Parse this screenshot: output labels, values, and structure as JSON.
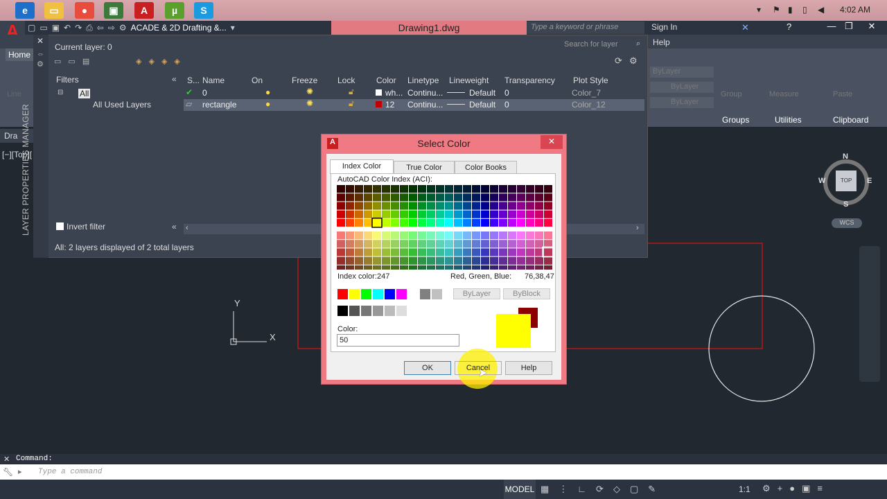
{
  "taskbar": {
    "time": "4:02 AM"
  },
  "title_bar": {
    "workspace": "ACADE & 2D Drafting &...",
    "document": "Drawing1.dwg",
    "search_placeholder": "Type a keyword or phrase",
    "sign_in": "Sign In"
  },
  "ribbon": {
    "home_tab": "Home",
    "help_tab": "Help",
    "line_label": "Line",
    "bylayer_1": "ByLayer",
    "bylayer_2": "ByLayer",
    "bylayer_3": "ByLayer",
    "group_label": "Group",
    "measure_label": "Measure",
    "paste_label": "Paste",
    "groups": [
      "Groups",
      "Utilities",
      "Clipboard"
    ]
  },
  "layer_manager": {
    "side_title": "LAYER PROPERTIES MANAGER",
    "current_layer": "Current layer: 0",
    "search_placeholder": "Search for layer",
    "filters_label": "Filters",
    "filter_all": "All",
    "filter_used": "All Used Layers",
    "invert_filter": "Invert filter",
    "status": "All: 2 layers displayed of 2 total layers",
    "columns": [
      "S...",
      "Name",
      "On",
      "Freeze",
      "Lock",
      "Color",
      "Linetype",
      "Lineweight",
      "Transparency",
      "Plot Style"
    ],
    "rows": [
      {
        "name": "0",
        "color_name": "wh...",
        "color_hex": "#ffffff",
        "linetype": "Continu...",
        "lineweight": "Default",
        "transparency": "0",
        "plot_style": "Color_7"
      },
      {
        "name": "rectangle",
        "color_name": "12",
        "color_hex": "#c00000",
        "linetype": "Continu...",
        "lineweight": "Default",
        "transparency": "0",
        "plot_style": "Color_12"
      }
    ]
  },
  "viewport": {
    "label": "[−][Top][",
    "drawing_tab": "Dra",
    "compass": {
      "n": "N",
      "s": "S",
      "e": "E",
      "w": "W",
      "top": "TOP"
    },
    "wcs": "WCS",
    "ucs_x": "X",
    "ucs_y": "Y"
  },
  "dialog": {
    "title": "Select Color",
    "tabs": [
      "Index Color",
      "True Color",
      "Color Books"
    ],
    "aci_label": "AutoCAD Color Index (ACI):",
    "index_color_label": "Index color:",
    "index_color_value": "247",
    "rgb_label": "Red, Green, Blue:",
    "rgb_value": "76,38,47",
    "bylayer": "ByLayer",
    "byblock": "ByBlock",
    "color_label": "Color:",
    "color_value": "50",
    "ok": "OK",
    "cancel": "Cancel",
    "help": "Help",
    "new_color": "#ffff00",
    "old_color": "#8b0000",
    "standard_colors": [
      "#ff0000",
      "#ffff00",
      "#00ff00",
      "#00ffff",
      "#0000ff",
      "#ff00ff",
      "#ffffff",
      "#808080",
      "#c0c0c0"
    ],
    "gray_colors": [
      "#000000",
      "#545454",
      "#767676",
      "#989898",
      "#bbbbbb",
      "#dddddd",
      "#ffffff"
    ]
  },
  "command": {
    "history": "Command:",
    "placeholder": "Type a command"
  },
  "status_bar": {
    "model": "MODEL",
    "scale": "1:1"
  }
}
